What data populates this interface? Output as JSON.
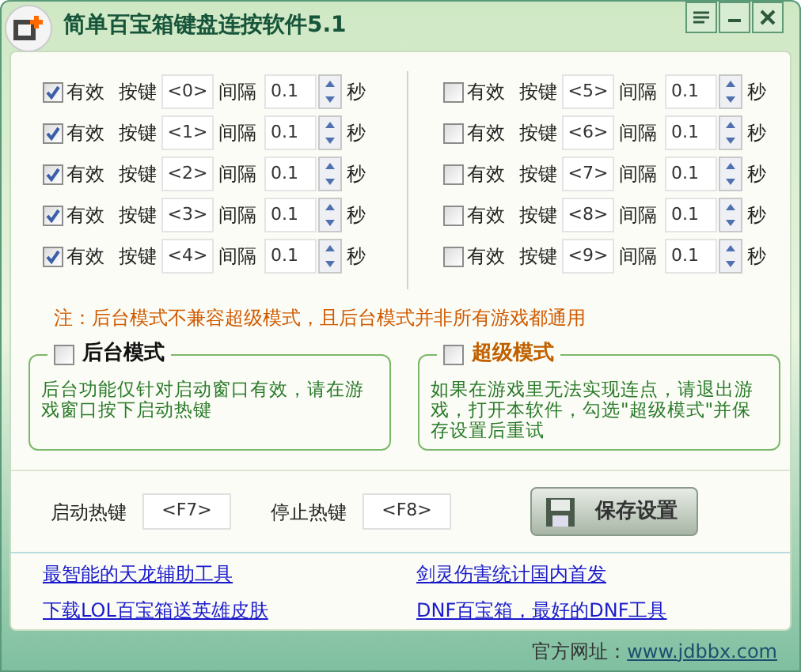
{
  "window": {
    "title": "简单百宝箱键盘连按软件5.1"
  },
  "keys": [
    {
      "enabled": true,
      "enabled_label": "有效",
      "key_label": "按键",
      "key": "<0>",
      "interval_label": "间隔",
      "interval": "0.1",
      "unit": "秒"
    },
    {
      "enabled": true,
      "enabled_label": "有效",
      "key_label": "按键",
      "key": "<1>",
      "interval_label": "间隔",
      "interval": "0.1",
      "unit": "秒"
    },
    {
      "enabled": true,
      "enabled_label": "有效",
      "key_label": "按键",
      "key": "<2>",
      "interval_label": "间隔",
      "interval": "0.1",
      "unit": "秒"
    },
    {
      "enabled": true,
      "enabled_label": "有效",
      "key_label": "按键",
      "key": "<3>",
      "interval_label": "间隔",
      "interval": "0.1",
      "unit": "秒"
    },
    {
      "enabled": true,
      "enabled_label": "有效",
      "key_label": "按键",
      "key": "<4>",
      "interval_label": "间隔",
      "interval": "0.1",
      "unit": "秒"
    },
    {
      "enabled": false,
      "enabled_label": "有效",
      "key_label": "按键",
      "key": "<5>",
      "interval_label": "间隔",
      "interval": "0.1",
      "unit": "秒"
    },
    {
      "enabled": false,
      "enabled_label": "有效",
      "key_label": "按键",
      "key": "<6>",
      "interval_label": "间隔",
      "interval": "0.1",
      "unit": "秒"
    },
    {
      "enabled": false,
      "enabled_label": "有效",
      "key_label": "按键",
      "key": "<7>",
      "interval_label": "间隔",
      "interval": "0.1",
      "unit": "秒"
    },
    {
      "enabled": false,
      "enabled_label": "有效",
      "key_label": "按键",
      "key": "<8>",
      "interval_label": "间隔",
      "interval": "0.1",
      "unit": "秒"
    },
    {
      "enabled": false,
      "enabled_label": "有效",
      "key_label": "按键",
      "key": "<9>",
      "interval_label": "间隔",
      "interval": "0.1",
      "unit": "秒"
    }
  ],
  "note": "注：后台模式不兼容超级模式，且后台模式并非所有游戏都通用",
  "modes": [
    {
      "kind": "background",
      "label": "后台模式",
      "checked": false,
      "description": "后台功能仅针对启动窗口有效，请在游戏窗口按下启动热键"
    },
    {
      "kind": "super",
      "label": "超级模式",
      "checked": false,
      "description": "如果在游戏里无法实现连点，请退出游戏，打开本软件，勾选\"超级模式\"并保存设置后重试"
    }
  ],
  "hotkeys": [
    {
      "label": "启动热键",
      "value": "<F7>"
    },
    {
      "label": "停止热键",
      "value": "<F8>"
    }
  ],
  "save_button": "保存设置",
  "links": [
    "最智能的天龙辅助工具",
    "剑灵伤害统计国内首发",
    "下载LOL百宝箱送英雄皮肤",
    "DNF百宝箱，最好的DNF工具"
  ],
  "footer": {
    "label": "官方网址：",
    "link": "www.jdbbx.com"
  }
}
